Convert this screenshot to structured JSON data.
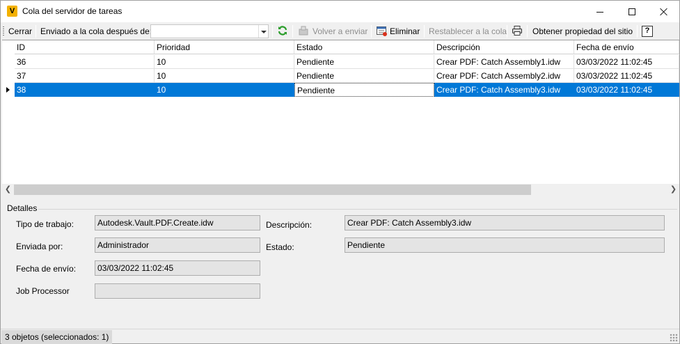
{
  "window": {
    "title": "Cola del servidor de tareas",
    "app_icon_letter": "V",
    "accent": "#0078d7"
  },
  "toolbar": {
    "close_label": "Cerrar",
    "queued_after_label": "Enviado a la cola después de:",
    "queued_after_value": "",
    "resubmit_label": "Volver a enviar",
    "delete_label": "Eliminar",
    "reset_queue_label": "Restablecer a la cola",
    "site_property_label": "Obtener propiedad del sitio",
    "help_label": "?"
  },
  "grid": {
    "columns": [
      "ID",
      "Prioridad",
      "Estado",
      "Descripción",
      "Fecha de envío"
    ],
    "rows": [
      {
        "id": "36",
        "priority": "10",
        "state": "Pendiente",
        "description": "Crear PDF: Catch Assembly1.idw",
        "date": "03/03/2022 11:02:45"
      },
      {
        "id": "37",
        "priority": "10",
        "state": "Pendiente",
        "description": "Crear PDF: Catch Assembly2.idw",
        "date": "03/03/2022 11:02:45"
      },
      {
        "id": "38",
        "priority": "10",
        "state": "Pendiente",
        "description": "Crear PDF: Catch Assembly3.idw",
        "date": "03/03/2022 11:02:45"
      }
    ],
    "selected_row": 2
  },
  "details": {
    "legend": "Detalles",
    "job_type_label": "Tipo de trabajo:",
    "job_type_value": "Autodesk.Vault.PDF.Create.idw",
    "sent_by_label": "Enviada por:",
    "sent_by_value": "Administrador",
    "sent_date_label": "Fecha de envío:",
    "sent_date_value": "03/03/2022 11:02:45",
    "job_processor_label": "Job Processor",
    "job_processor_value": "",
    "description_label": "Descripción:",
    "description_value": "Crear PDF: Catch Assembly3.idw",
    "state_label": "Estado:",
    "state_value": "Pendiente"
  },
  "statusbar": {
    "text": "3 objetos (seleccionados: 1)"
  }
}
